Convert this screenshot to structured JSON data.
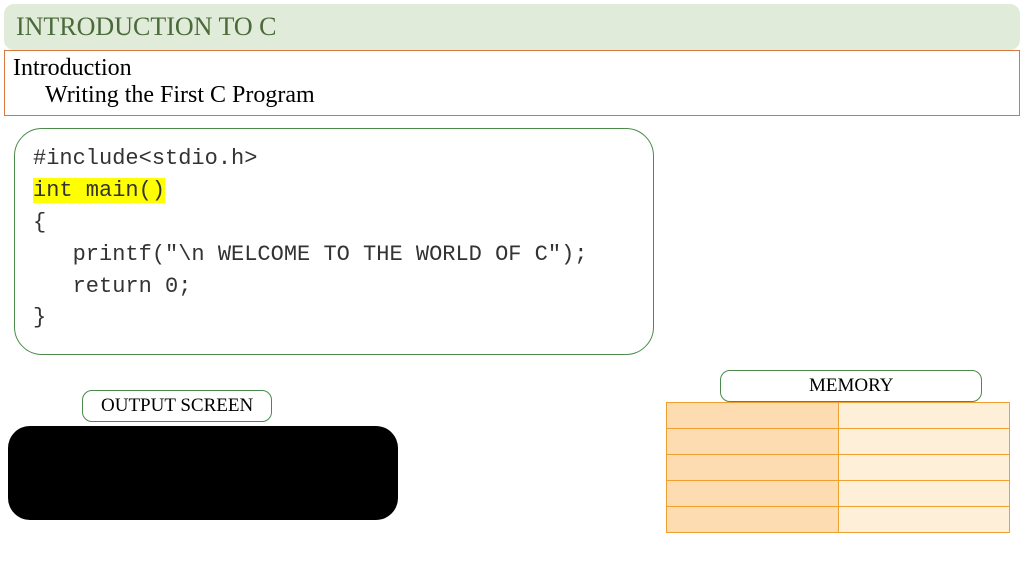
{
  "title": "INTRODUCTION TO C",
  "subtitle": {
    "line1": "Introduction",
    "line2": "Writing the First C Program"
  },
  "code": {
    "line1": "#include<stdio.h>",
    "line2": "int main()",
    "line3": "{",
    "line4": "   printf(\"\\n WELCOME TO THE WORLD OF C\");",
    "line5": "   return 0;",
    "line6": "}"
  },
  "output": {
    "label": "OUTPUT SCREEN"
  },
  "memory": {
    "label": "MEMORY",
    "rows": 5
  }
}
